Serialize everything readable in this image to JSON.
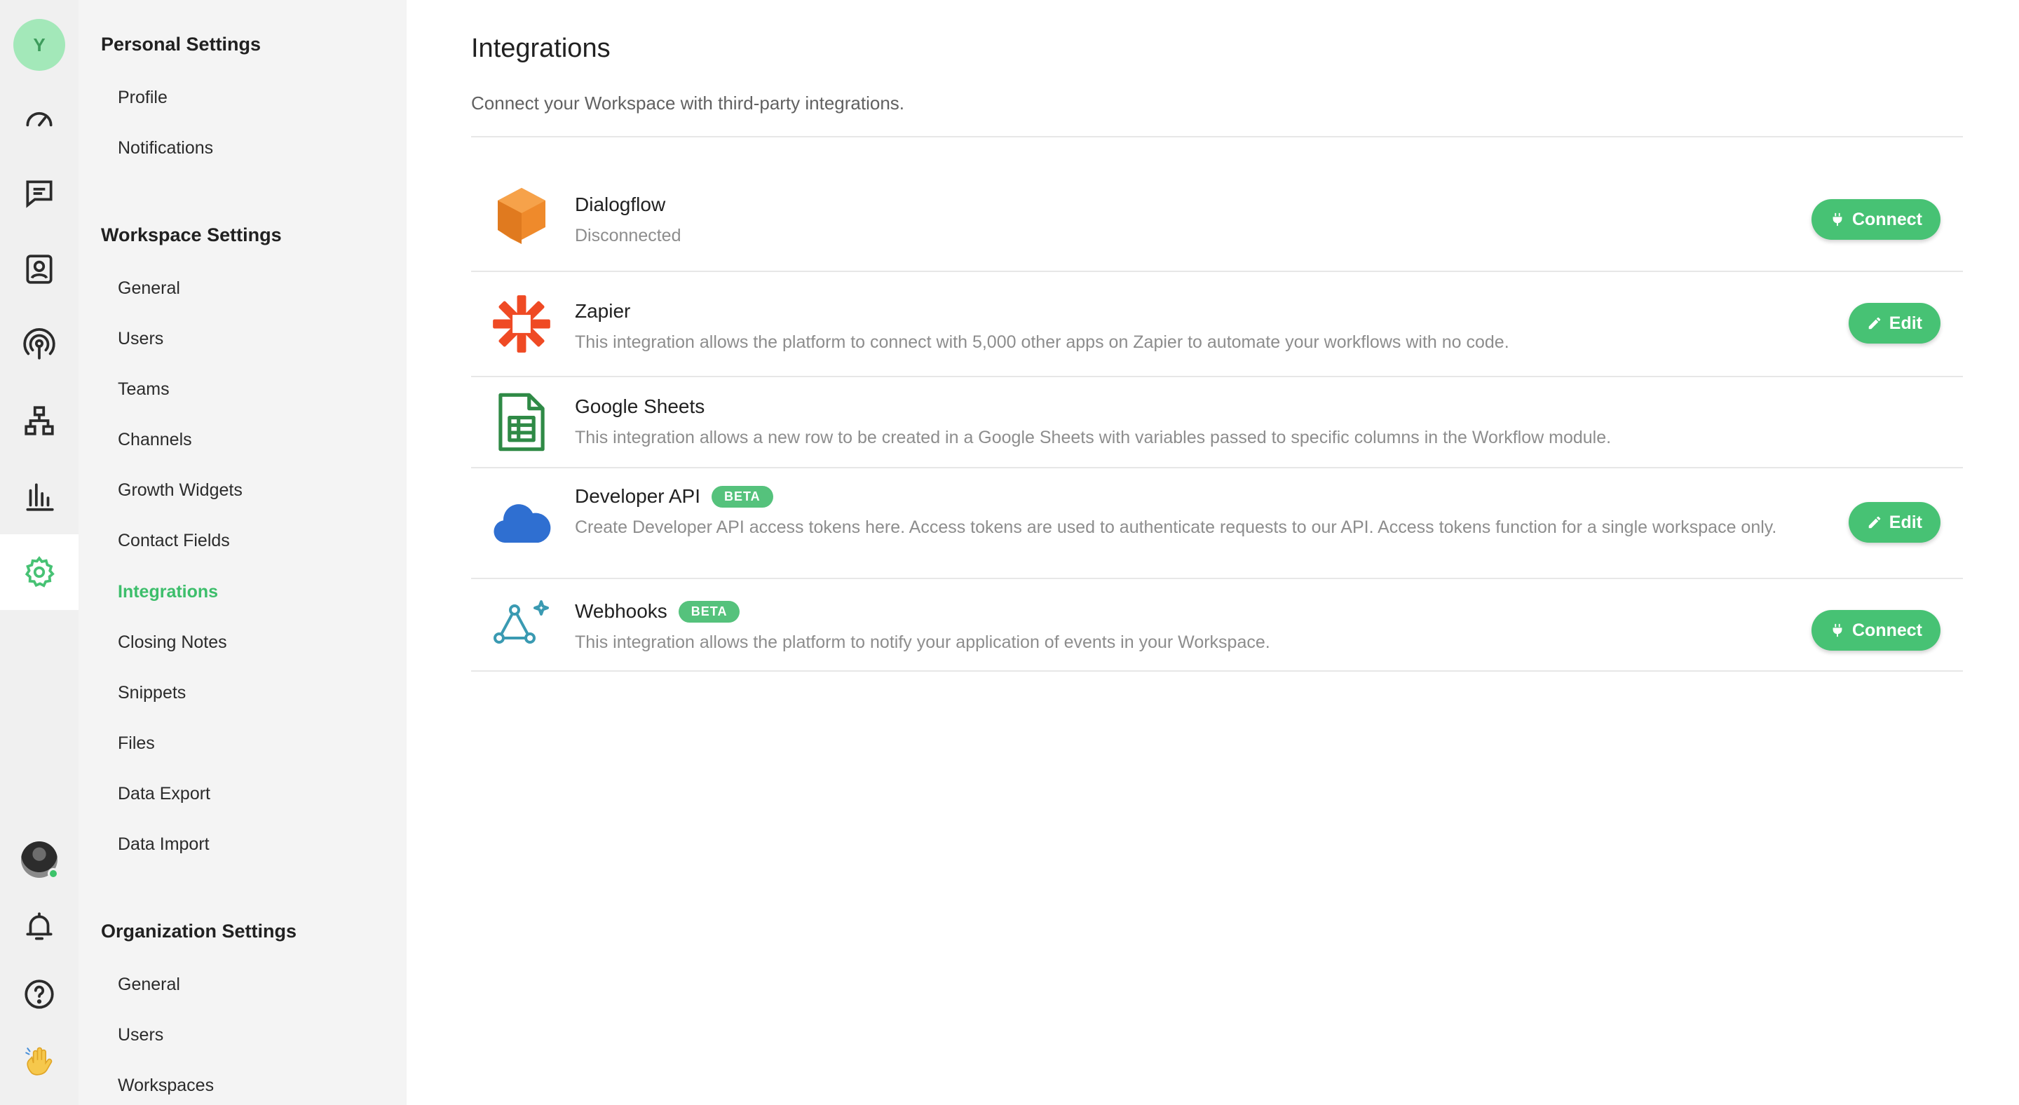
{
  "rail": {
    "workspace_initial": "Y",
    "icons": [
      "dashboard-icon",
      "conversations-icon",
      "contacts-icon",
      "broadcast-icon",
      "workflows-icon",
      "reports-icon",
      "settings-icon"
    ],
    "bottom_icons": [
      "user-avatar",
      "notifications-bell-icon",
      "help-icon",
      "wave-hand-icon"
    ]
  },
  "nav": {
    "personal_title": "Personal Settings",
    "personal_items": [
      "Profile",
      "Notifications"
    ],
    "workspace_title": "Workspace Settings",
    "workspace_items": [
      "General",
      "Users",
      "Teams",
      "Channels",
      "Growth Widgets",
      "Contact Fields",
      "Integrations",
      "Closing Notes",
      "Snippets",
      "Files",
      "Data Export",
      "Data Import"
    ],
    "active_item": "Integrations",
    "organization_title": "Organization Settings",
    "organization_items": [
      "General",
      "Users",
      "Workspaces"
    ]
  },
  "main": {
    "title": "Integrations",
    "subtitle": "Connect your Workspace with third-party integrations."
  },
  "integrations": [
    {
      "name": "Dialogflow",
      "badge": "",
      "description": "Disconnected",
      "action": "Connect",
      "logo": "dialogflow-logo"
    },
    {
      "name": "Zapier",
      "badge": "",
      "description": "This integration allows the platform to connect with 5,000 other apps on Zapier to automate your workflows with no code.",
      "action": "Edit",
      "logo": "zapier-logo"
    },
    {
      "name": "Google Sheets",
      "badge": "",
      "description": "This integration allows a new row to be created in a Google Sheets with variables passed to specific columns in the Workflow module.",
      "action": "",
      "logo": "google-sheets-logo"
    },
    {
      "name": "Developer API",
      "badge": "BETA",
      "description": "Create Developer API access tokens here. Access tokens are used to authenticate requests to our API. Access tokens function for a single workspace only.",
      "action": "Edit",
      "logo": "cloud-logo"
    },
    {
      "name": "Webhooks",
      "badge": "BETA",
      "description": "This integration allows the platform to notify your application of events in your Workspace.",
      "action": "Connect",
      "logo": "webhooks-logo"
    }
  ],
  "colors": {
    "accent": "#47c274",
    "rail_bg": "#f0f0f0",
    "nav_bg": "#f4f4f4",
    "active_nav": "#3dbe6b"
  }
}
